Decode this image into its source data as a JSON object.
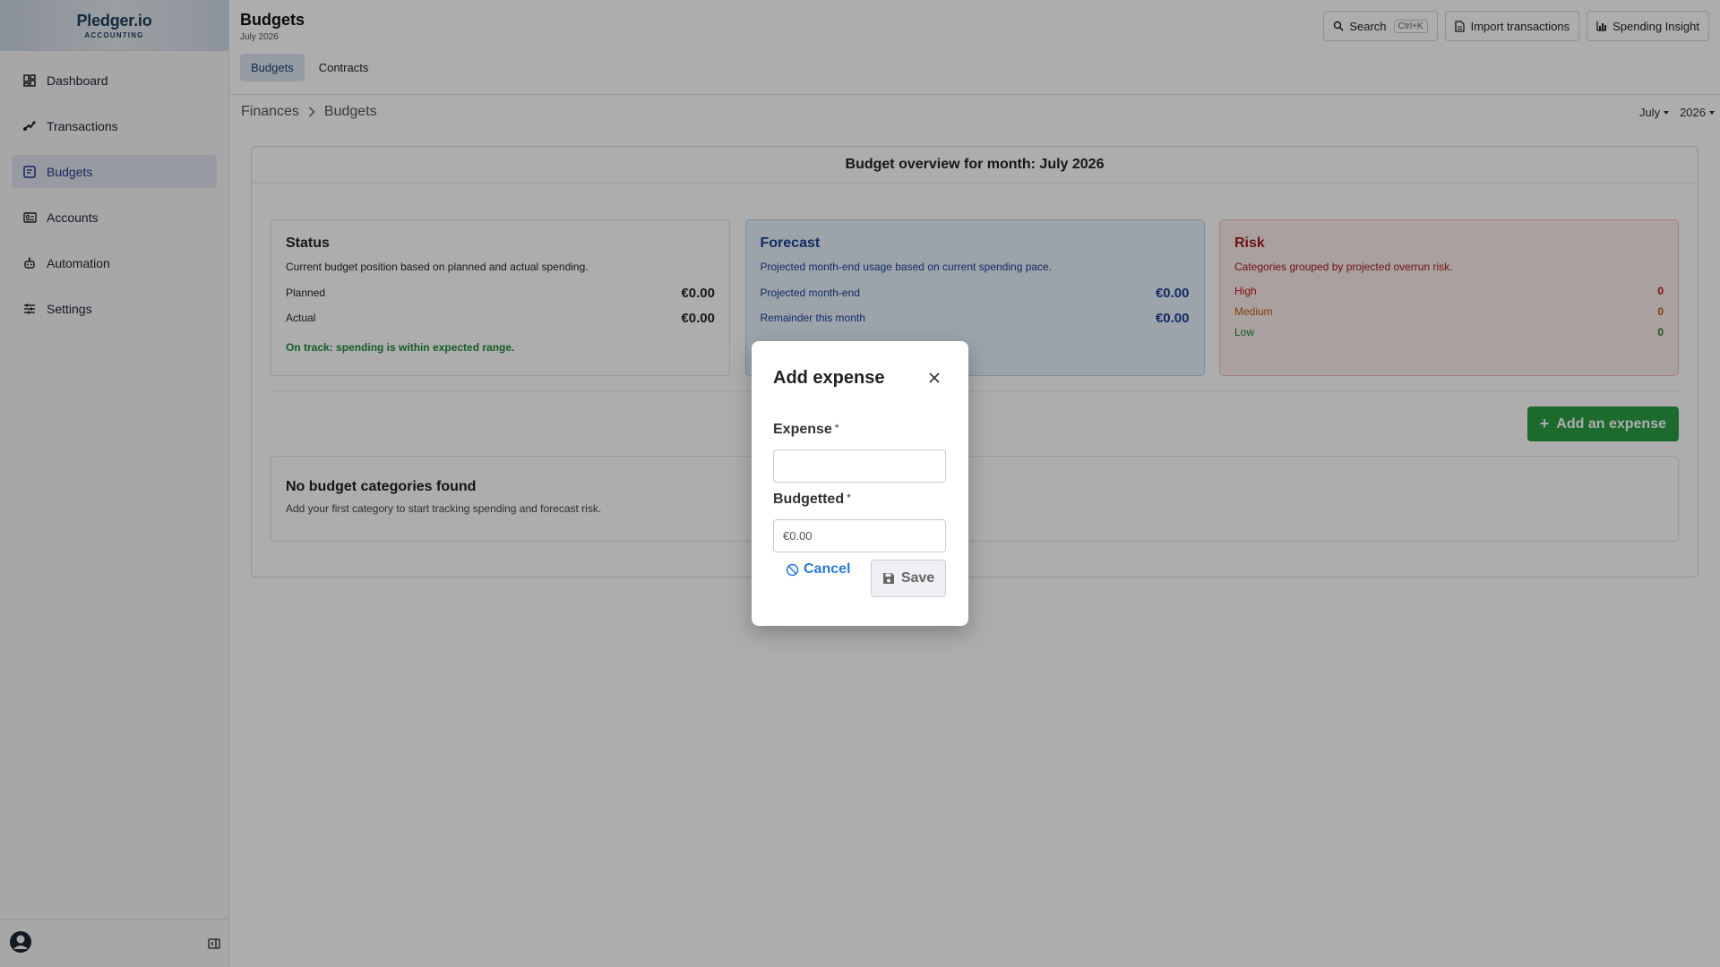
{
  "app": {
    "logo_name": "Pledger.io",
    "logo_sub": "ACCOUNTING"
  },
  "sidebar": {
    "items": [
      {
        "label": "Dashboard",
        "icon": "dashboard-icon"
      },
      {
        "label": "Transactions",
        "icon": "transactions-icon"
      },
      {
        "label": "Budgets",
        "icon": "budgets-icon",
        "active": true
      },
      {
        "label": "Accounts",
        "icon": "accounts-icon"
      },
      {
        "label": "Automation",
        "icon": "automation-icon"
      },
      {
        "label": "Settings",
        "icon": "settings-icon"
      }
    ]
  },
  "header": {
    "title": "Budgets",
    "subtitle": "July 2026",
    "tabs": [
      {
        "label": "Budgets",
        "active": true
      },
      {
        "label": "Contracts"
      }
    ],
    "search_label": "Search",
    "search_shortcut": "Ctrl+K",
    "import_label": "Import transactions",
    "insight_label": "Spending Insight"
  },
  "breadcrumb": {
    "items": [
      "Finances",
      "Budgets"
    ]
  },
  "period": {
    "month": "July",
    "year": "2026"
  },
  "overview": {
    "title": "Budget overview for month: July 2026",
    "status": {
      "title": "Status",
      "description": "Current budget position based on planned and actual spending.",
      "planned_label": "Planned",
      "planned_value": "€0.00",
      "actual_label": "Actual",
      "actual_value": "€0.00",
      "message": "On track: spending is within expected range."
    },
    "forecast": {
      "title": "Forecast",
      "description": "Projected month-end usage based on current spending pace.",
      "projected_label": "Projected month-end",
      "projected_value": "€0.00",
      "remainder_label": "Remainder this month",
      "remainder_value": "€0.00"
    },
    "risk": {
      "title": "Risk",
      "description": "Categories grouped by projected overrun risk.",
      "high_label": "High",
      "high_value": "0",
      "medium_label": "Medium",
      "medium_value": "0",
      "low_label": "Low",
      "low_value": "0"
    },
    "add_expense_label": "Add an expense",
    "empty_title": "No budget categories found",
    "empty_text": "Add your first category to start tracking spending and forecast risk."
  },
  "modal": {
    "title": "Add expense",
    "expense_label": "Expense",
    "expense_value": "",
    "budgeted_label": "Budgetted",
    "budgeted_placeholder": "€0.00",
    "required_marker": "*",
    "cancel_label": "Cancel",
    "save_label": "Save"
  },
  "colors": {
    "accent": "#2a9d45",
    "link": "#2b7bd8",
    "forecast": "#1c3f94",
    "risk": "#a01d1d"
  }
}
